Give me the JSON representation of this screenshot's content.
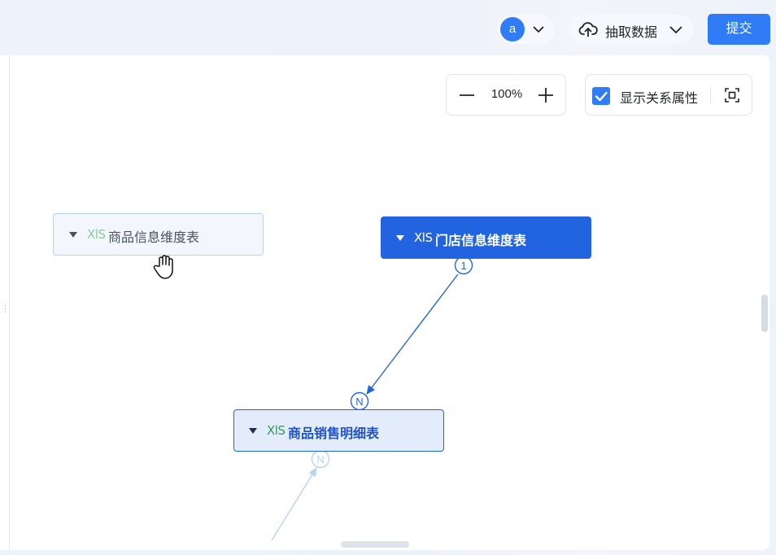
{
  "header": {
    "avatar_letter": "a",
    "extract_label": "抽取数据",
    "submit_label": "提交"
  },
  "toolbar": {
    "zoom_value": "100%",
    "show_relations_label": "显示关系属性",
    "show_relations_checked": true
  },
  "nodes": [
    {
      "type_label": "XlS",
      "name": "商品信息维度表",
      "state": "hover"
    },
    {
      "type_label": "XlS",
      "name": "门店信息维度表",
      "state": "selected"
    },
    {
      "type_label": "XlS",
      "name": "商品销售明细表",
      "state": "related"
    }
  ],
  "relations": [
    {
      "from": "门店信息维度表",
      "to": "商品销售明细表",
      "from_cardinality": "1",
      "to_cardinality": "N"
    },
    {
      "to": "商品销售明细表",
      "to_cardinality": "N"
    }
  ],
  "colors": {
    "accent": "#2f7cf6",
    "selected_node": "#2264e0",
    "xls_icon_green": "#2e9e4f",
    "faded_edge": "#b8d2f3"
  }
}
